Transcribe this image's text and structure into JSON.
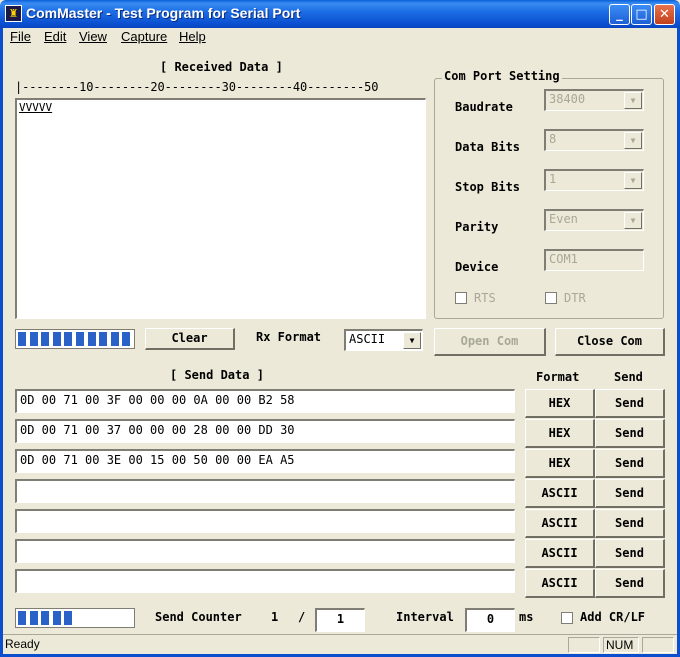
{
  "window": {
    "title": "ComMaster - Test Program for Serial Port"
  },
  "menu": [
    "File",
    "Edit",
    "View",
    "Capture",
    "Help"
  ],
  "received": {
    "header": "[ Received Data ]",
    "ruler": "|--------10--------20--------30--------40--------50",
    "content": "VVVVV",
    "progress_blocks": 10,
    "clear_label": "Clear",
    "rx_format_label": "Rx Format",
    "rx_format_value": "ASCII"
  },
  "com_settings": {
    "group_label": "Com Port Setting",
    "baudrate_label": "Baudrate",
    "baudrate_value": "38400",
    "databits_label": "Data Bits",
    "databits_value": "8",
    "stopbits_label": "Stop Bits",
    "stopbits_value": "1",
    "parity_label": "Parity",
    "parity_value": "Even",
    "device_label": "Device",
    "device_value": "COM1",
    "rts_label": "RTS",
    "dtr_label": "DTR",
    "open_label": "Open Com",
    "close_label": "Close Com"
  },
  "send": {
    "header": "[ Send Data ]",
    "format_header": "Format",
    "send_header": "Send",
    "rows": [
      {
        "data": "0D 00 71 00 3F 00 00 00 0A 00 00 B2 58",
        "format": "HEX",
        "send": "Send"
      },
      {
        "data": "0D 00 71 00 37 00 00 00 28 00 00 DD 30",
        "format": "HEX",
        "send": "Send"
      },
      {
        "data": "0D 00 71 00 3E 00 15 00 50 00 00 EA A5",
        "format": "HEX",
        "send": "Send"
      },
      {
        "data": "",
        "format": "ASCII",
        "send": "Send"
      },
      {
        "data": "",
        "format": "ASCII",
        "send": "Send"
      },
      {
        "data": "",
        "format": "ASCII",
        "send": "Send"
      },
      {
        "data": "",
        "format": "ASCII",
        "send": "Send"
      }
    ],
    "progress_blocks": 5,
    "counter_label": "Send Counter",
    "counter_current": "1",
    "counter_sep": "/",
    "counter_total": "1",
    "interval_label": "Interval",
    "interval_value": "0",
    "interval_unit": "ms",
    "add_crlf_label": "Add CR/LF"
  },
  "status": {
    "text": "Ready",
    "num": "NUM"
  }
}
